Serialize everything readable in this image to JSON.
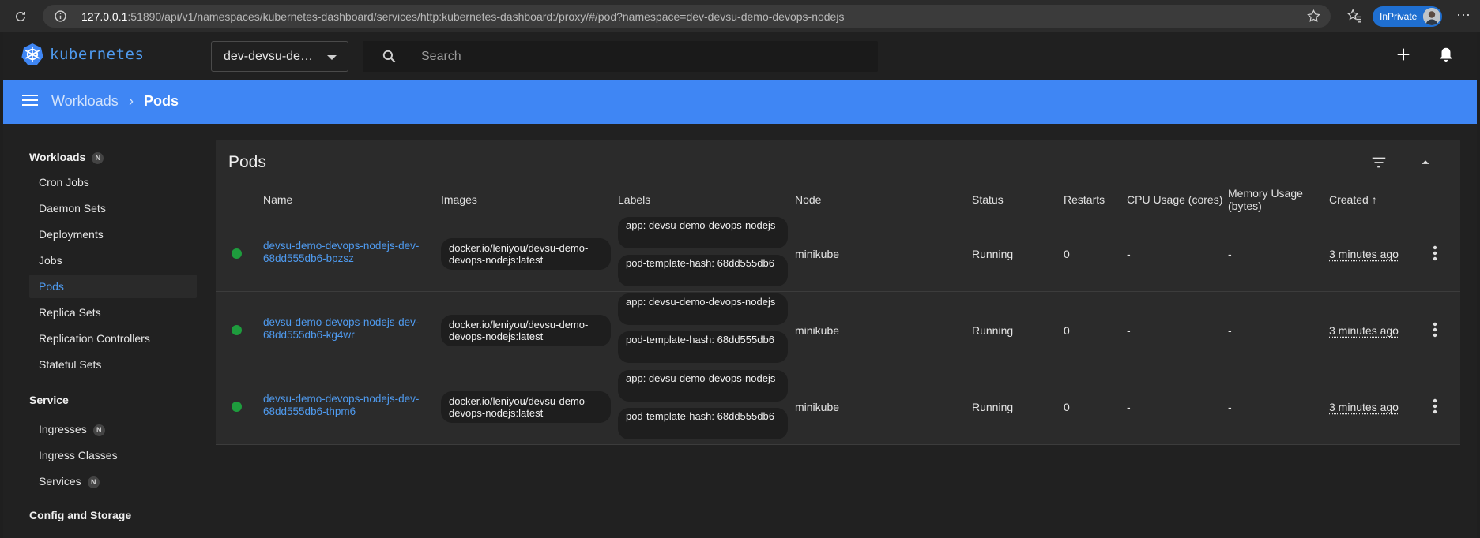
{
  "browser": {
    "url_host": "127.0.0.1",
    "url_rest": ":51890/api/v1/namespaces/kubernetes-dashboard/services/http:kubernetes-dashboard:/proxy/#/pod?namespace=dev-devsu-demo-devops-nodejs",
    "inprivate_label": "InPrivate",
    "icons": [
      "reload-icon",
      "info-icon",
      "star-icon",
      "favorites-icon",
      "avatar",
      "more-icon"
    ]
  },
  "app": {
    "logo_text": "kubernetes",
    "namespace": "dev-devsu-demo-devops-nodejs",
    "search_placeholder": "Search",
    "accent_color": "#3f86f4"
  },
  "breadcrumb": {
    "parent": "Workloads",
    "separator": "›",
    "current": "Pods"
  },
  "sidebar": {
    "sections": [
      {
        "title": "Workloads",
        "badge": "N",
        "items": [
          {
            "label": "Cron Jobs"
          },
          {
            "label": "Daemon Sets"
          },
          {
            "label": "Deployments"
          },
          {
            "label": "Jobs"
          },
          {
            "label": "Pods",
            "active": true
          },
          {
            "label": "Replica Sets"
          },
          {
            "label": "Replication Controllers"
          },
          {
            "label": "Stateful Sets"
          }
        ]
      },
      {
        "title": "Service",
        "items": [
          {
            "label": "Ingresses",
            "badge": "N"
          },
          {
            "label": "Ingress Classes"
          },
          {
            "label": "Services",
            "badge": "N"
          }
        ]
      },
      {
        "title": "Config and Storage",
        "items": []
      }
    ]
  },
  "pods": {
    "title": "Pods",
    "columns": {
      "name": "Name",
      "images": "Images",
      "labels": "Labels",
      "node": "Node",
      "status": "Status",
      "restarts": "Restarts",
      "cpu": "CPU Usage (cores)",
      "memory": "Memory Usage (bytes)",
      "created": "Created",
      "sort_indicator": "↑"
    },
    "rows": [
      {
        "name": "devsu-demo-devops-nodejs-dev-68dd555db6-bpzsz",
        "image": "docker.io/leniyou/devsu-demo-devops-nodejs:latest",
        "label_app": "app: devsu-demo-devops-nodejs",
        "label_hash": "pod-template-hash: 68dd555db6",
        "node": "minikube",
        "status": "Running",
        "restarts": "0",
        "cpu": "-",
        "memory": "-",
        "created": "3 minutes ago",
        "status_color": "#1e9c3d"
      },
      {
        "name": "devsu-demo-devops-nodejs-dev-68dd555db6-kg4wr",
        "image": "docker.io/leniyou/devsu-demo-devops-nodejs:latest",
        "label_app": "app: devsu-demo-devops-nodejs",
        "label_hash": "pod-template-hash: 68dd555db6",
        "node": "minikube",
        "status": "Running",
        "restarts": "0",
        "cpu": "-",
        "memory": "-",
        "created": "3 minutes ago",
        "status_color": "#1e9c3d"
      },
      {
        "name": "devsu-demo-devops-nodejs-dev-68dd555db6-thpm6",
        "image": "docker.io/leniyou/devsu-demo-devops-nodejs:latest",
        "label_app": "app: devsu-demo-devops-nodejs",
        "label_hash": "pod-template-hash: 68dd555db6",
        "node": "minikube",
        "status": "Running",
        "restarts": "0",
        "cpu": "-",
        "memory": "-",
        "created": "3 minutes ago",
        "status_color": "#1e9c3d"
      }
    ]
  }
}
